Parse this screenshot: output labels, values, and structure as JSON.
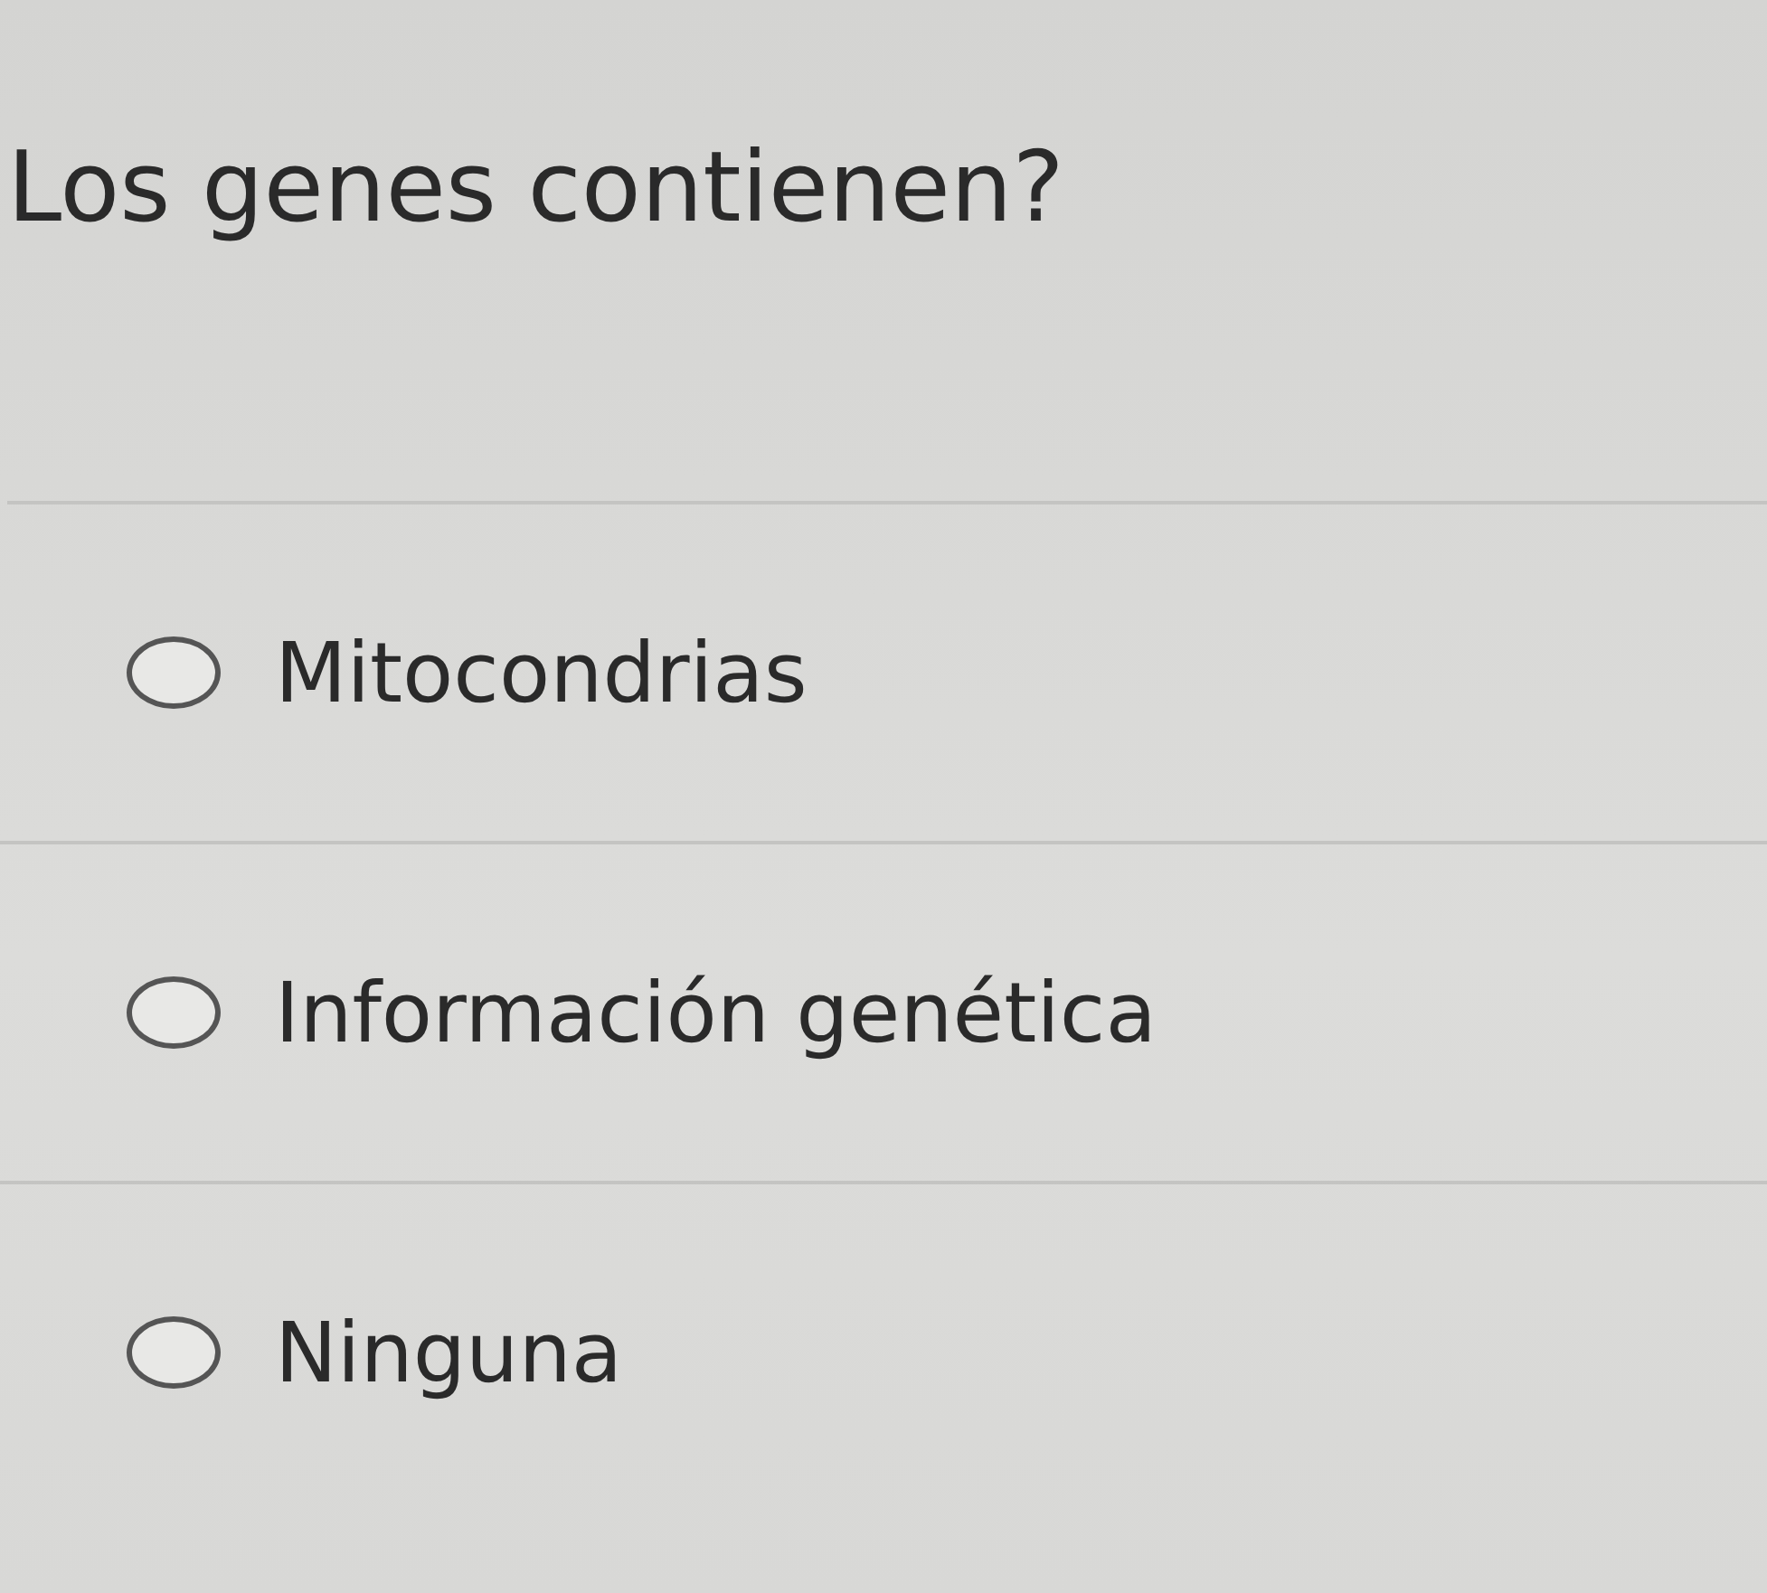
{
  "question": "Los genes contienen?",
  "options": [
    {
      "label": "Mitocondrias",
      "selected": false
    },
    {
      "label": "Información genética",
      "selected": false
    },
    {
      "label": "Ninguna",
      "selected": false
    }
  ]
}
